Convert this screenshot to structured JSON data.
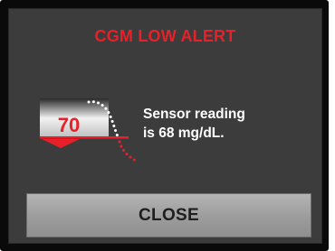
{
  "alert": {
    "title": "CGM LOW ALERT",
    "reading_value": "70",
    "message_line1": "Sensor reading",
    "message_line2": "is 68 mg/dL.",
    "close_label": "CLOSE"
  },
  "colors": {
    "alert_red": "#e8202a",
    "screen_bg": "#3c3c3c",
    "text_white": "#ffffff",
    "button_grey": "#a0a0a0"
  },
  "icons": {
    "trend": "low-threshold-trend-icon"
  }
}
